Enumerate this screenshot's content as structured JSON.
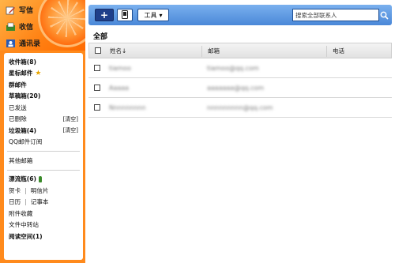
{
  "sidebar": {
    "top_buttons": [
      {
        "label": "写信",
        "icon": "pencil-icon"
      },
      {
        "label": "收信",
        "icon": "inbox-icon"
      },
      {
        "label": "通讯录",
        "icon": "contacts-icon"
      }
    ],
    "folders": {
      "inbox": "收件箱(8)",
      "starred": "星标邮件",
      "group_mail": "群邮件",
      "drafts": "草稿箱(20)",
      "sent": "已发送",
      "deleted": "已删除",
      "deleted_clear": "[清空]",
      "spam": "垃圾箱(4)",
      "spam_clear": "[清空]",
      "qq_subscribe": "QQ邮件订阅"
    },
    "other_mailbox": "其他邮箱",
    "apps": {
      "drift_bottle": "漂流瓶(6)",
      "greeting_card": "贺卡",
      "postcard": "明信片",
      "calendar": "日历",
      "notepad": "记事本",
      "attachments": "附件收藏",
      "file_transfer": "文件中转站",
      "reading_space": "阅读空间(1)"
    }
  },
  "toolbar": {
    "add_label": "+",
    "tools_label": "工具",
    "search_placeholder": "搜索全部联系人"
  },
  "section_title": "全部",
  "table": {
    "columns": [
      "姓名↓",
      "邮箱",
      "电话"
    ],
    "rows": [
      {
        "name": "tiamoo",
        "email": "tiamoo@qq.com",
        "phone": ""
      },
      {
        "name": "Aaaaa",
        "email": "aaaaaaa@qq.com",
        "phone": ""
      },
      {
        "name": "Nnnnnnnnn",
        "email": "nnnnnnnnn@qq.com",
        "phone": ""
      }
    ]
  },
  "colors": {
    "sidebar_orange": "#ff8a1c",
    "toolbar_blue": "#4a88d8",
    "add_button": "#1f3f8a"
  }
}
